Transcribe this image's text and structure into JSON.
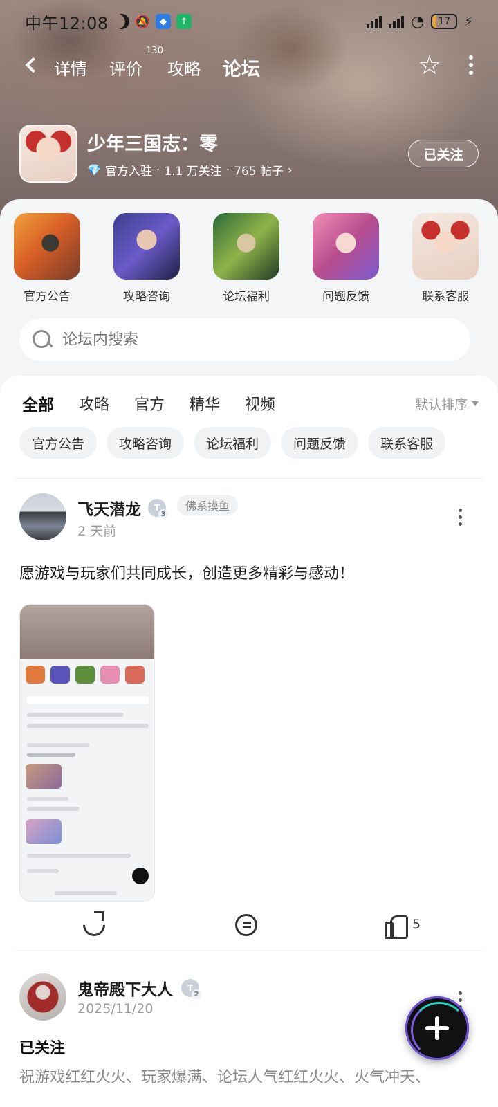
{
  "status_bar": {
    "time": "中午12:08",
    "battery": "17"
  },
  "nav": {
    "tabs": [
      {
        "label": "详情"
      },
      {
        "label": "评价",
        "badge": "130"
      },
      {
        "label": "攻略"
      },
      {
        "label": "论坛"
      }
    ],
    "active_tab": "论坛"
  },
  "game": {
    "title": "少年三国志：零",
    "official": "官方入驻",
    "followers": "1.1 万关注",
    "posts": "765 帖子",
    "follow_button": "已关注"
  },
  "categories": [
    {
      "label": "官方公告"
    },
    {
      "label": "攻略咨询"
    },
    {
      "label": "论坛福利"
    },
    {
      "label": "问题反馈"
    },
    {
      "label": "联系客服"
    }
  ],
  "search": {
    "placeholder": "论坛内搜索"
  },
  "tabs": [
    {
      "label": "全部"
    },
    {
      "label": "攻略"
    },
    {
      "label": "官方"
    },
    {
      "label": "精华"
    },
    {
      "label": "视频"
    }
  ],
  "sort": "默认排序",
  "chips": [
    {
      "label": "官方公告"
    },
    {
      "label": "攻略咨询"
    },
    {
      "label": "论坛福利"
    },
    {
      "label": "问题反馈"
    },
    {
      "label": "联系客服"
    }
  ],
  "posts": [
    {
      "author": "飞天潜龙",
      "level": "3",
      "tag": "佛系摸鱼",
      "time": "2 天前",
      "text": "愿游戏与玩家们共同成长，创造更多精彩与感动！",
      "likes": "5"
    },
    {
      "author": "鬼帝殿下大人",
      "level": "2",
      "time": "2025/11/20",
      "title": "已关注",
      "text": "祝游戏红红火火、玩家爆满、论坛人气红红火火、火气冲天、"
    }
  ],
  "colors": {
    "accent": "#1fd2c0",
    "fab": "#111111"
  }
}
